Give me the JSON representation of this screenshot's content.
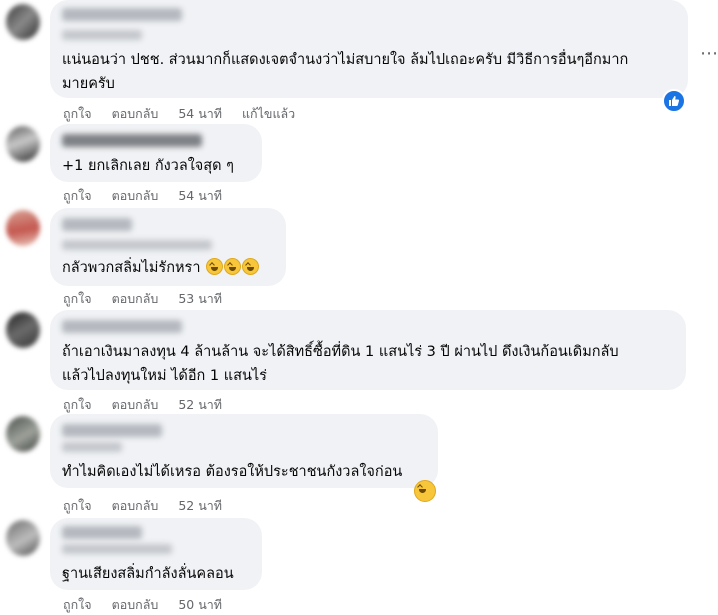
{
  "actions": {
    "like": "ถูกใจ",
    "reply": "ตอบกลับ",
    "edited": "แก้ไขแล้ว"
  },
  "comments": [
    {
      "text_lines": [
        "แน่นอนว่า ปชช. ส่วนมากก็แสดงเจตจำนงว่าไม่สบายใจ ล้มไปเถอะครับ มีวิธีการอื่นๆอีกมาก",
        "มายครับ"
      ],
      "time": "54 นาที",
      "edited": true,
      "reaction": "like-icon"
    },
    {
      "text_lines": [
        "+1 ยกเลิกเลย กังวลใจสุด ๆ"
      ],
      "time": "54 นาที"
    },
    {
      "text_lines": [
        "กลัวพวกสลิ่มไม่รักหรา"
      ],
      "emoji_count": 3,
      "time": "53 นาที"
    },
    {
      "text_lines": [
        "ถ้าเอาเงินมาลงทุน 4 ล้านล้าน จะได้สิทธิ์ซื้อที่ดิน 1 แสนไร่ 3 ปี ผ่านไป ดึงเงินก้อนเดิมกลับ",
        "แล้วไปลงทุนใหม่ ได้อีก 1 แสนไร่"
      ],
      "time": "52 นาที"
    },
    {
      "text_lines": [
        "ทำไมคิดเองไม่ได้เหรอ ต้องรอให้ประชาชนกังวลใจก่อน"
      ],
      "time": "52 นาที",
      "reaction": "laughing-emoji-icon"
    },
    {
      "text_lines": [
        "ฐานเสียงสลิ่มกำลังลั่นคลอน"
      ],
      "time": "50 นาที"
    }
  ],
  "colors": {
    "bubble": "#f0f2f5",
    "meta_text": "#65676b",
    "like_blue": "#1b74e4"
  }
}
